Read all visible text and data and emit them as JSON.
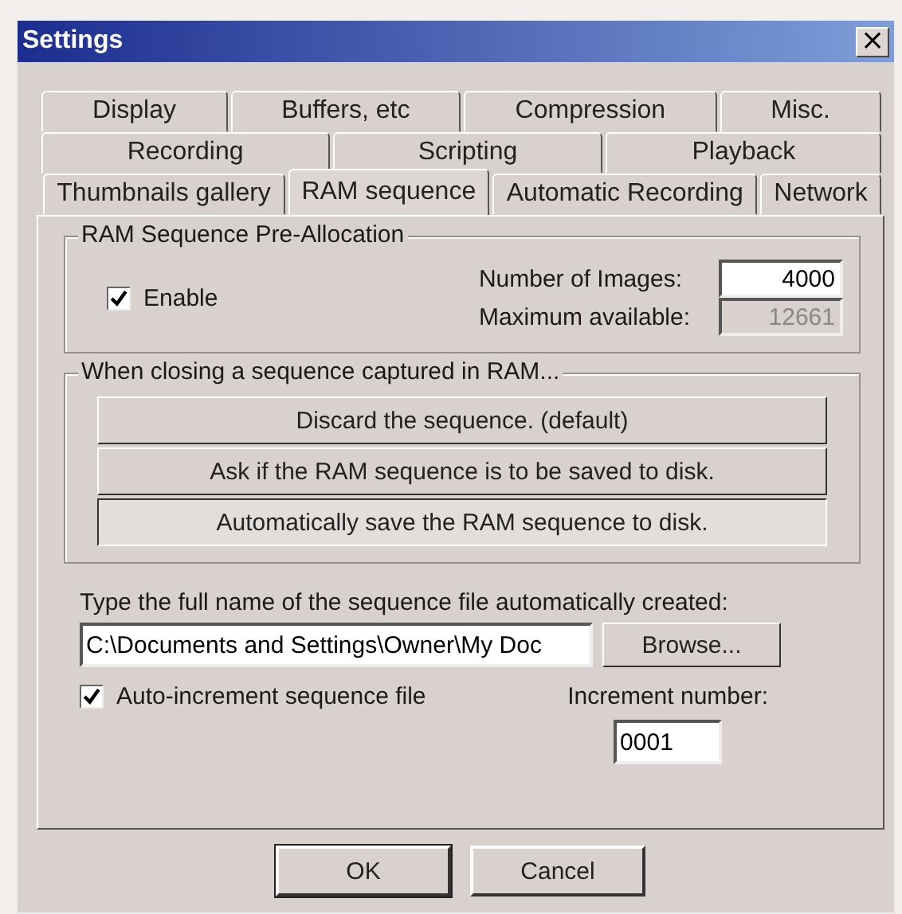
{
  "window": {
    "title": "Settings",
    "close": "×"
  },
  "tab_rows": [
    [
      {
        "label": "Display",
        "selected": false
      },
      {
        "label": "Buffers, etc",
        "selected": false
      },
      {
        "label": "Compression",
        "selected": false
      },
      {
        "label": "Misc.",
        "selected": false
      }
    ],
    [
      {
        "label": "Recording",
        "selected": false
      },
      {
        "label": "Scripting",
        "selected": false
      },
      {
        "label": "Playback",
        "selected": false
      }
    ],
    [
      {
        "label": "Thumbnails gallery",
        "selected": false
      },
      {
        "label": "RAM sequence",
        "selected": true
      },
      {
        "label": "Automatic Recording",
        "selected": false
      },
      {
        "label": "Network",
        "selected": false
      }
    ]
  ],
  "preallocation": {
    "title": "RAM Sequence  Pre-Allocation",
    "enable": {
      "label": "Enable",
      "checked": true
    },
    "number_label": "Number of Images:",
    "number_value": "4000",
    "maximum_label": "Maximum available:",
    "maximum_value": "12661"
  },
  "closing": {
    "title": "When closing a sequence captured in RAM...",
    "options": [
      {
        "label": "Discard the sequence. (default)",
        "selected": false
      },
      {
        "label": "Ask if the RAM sequence is to be saved to disk.",
        "selected": false
      },
      {
        "label": "Automatically save the RAM sequence to disk.",
        "selected": true
      }
    ]
  },
  "file": {
    "label": "Type the full name of the sequence file automatically created:",
    "value": "C:\\Documents and Settings\\Owner\\My Doc",
    "browse": "Browse..."
  },
  "auto_increment": {
    "label": "Auto-increment sequence file",
    "checked": true
  },
  "increment": {
    "label": "Increment number:",
    "value": "0001"
  },
  "buttons": [
    "OK",
    "Cancel"
  ]
}
